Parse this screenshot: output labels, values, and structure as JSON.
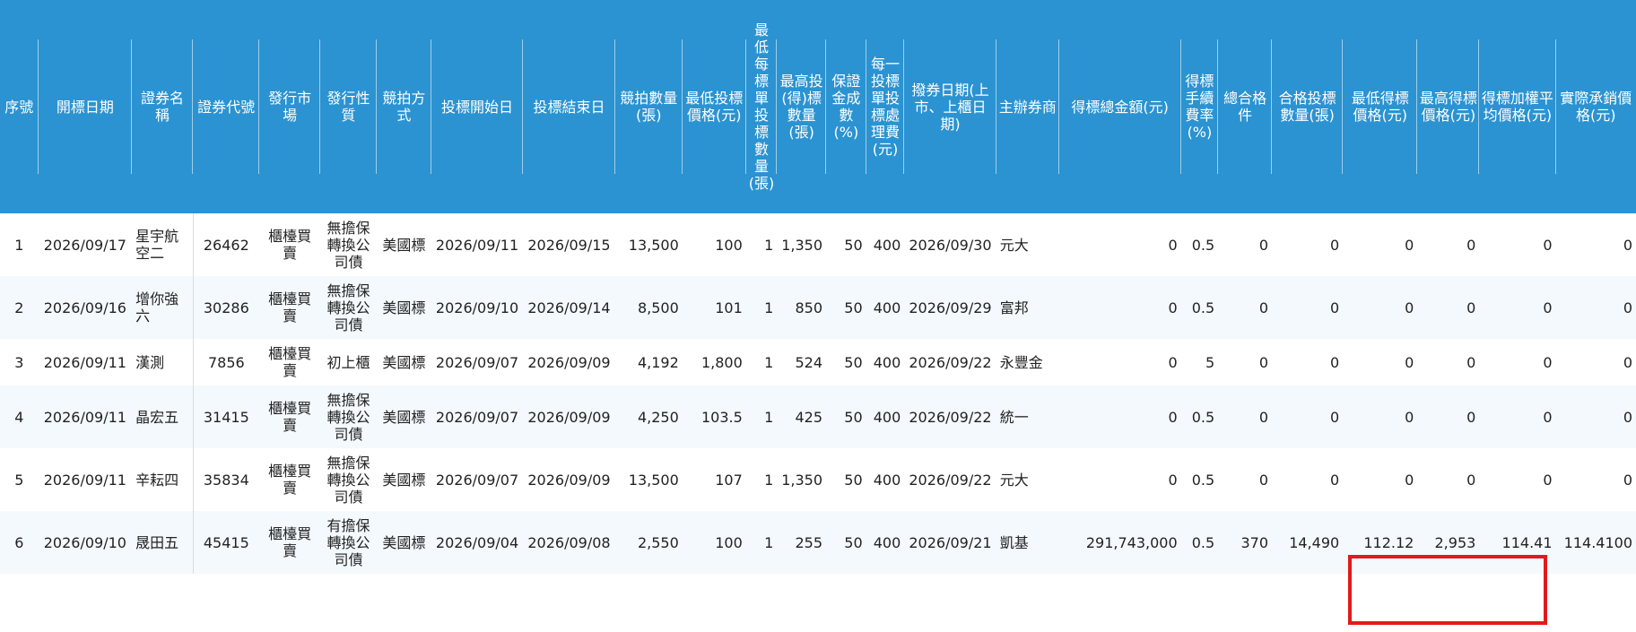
{
  "headers": [
    "序號",
    "開標日期",
    "證券名稱",
    "證券代號",
    "發行市場",
    "發行性質",
    "競拍方式",
    "投標開始日",
    "投標結束日",
    "競拍數量(張)",
    "最低投標價格(元)",
    "最低每標單投標數量(張)",
    "最高投(得)標數量(張)",
    "保證金成數(%)",
    "每一投標單投標處理費(元)",
    "撥券日期(上市、上櫃日期)",
    "主辦券商",
    "得標總金額(元)",
    "得標手續費率(%)",
    "總合格件",
    "合格投標數量(張)",
    "最低得標價格(元)",
    "最高得標價格(元)",
    "得標加權平均價格(元)",
    "實際承銷價格(元)"
  ],
  "rows": [
    [
      "1",
      "2026/09/17",
      "星宇航空二",
      "26462",
      "櫃檯買賣",
      "無擔保轉換公司債",
      "美國標",
      "2026/09/11",
      "2026/09/15",
      "13,500",
      "100",
      "1",
      "1,350",
      "50",
      "400",
      "2026/09/30",
      "元大",
      "0",
      "0.5",
      "0",
      "0",
      "0",
      "0",
      "0",
      "0"
    ],
    [
      "2",
      "2026/09/16",
      "增你強六",
      "30286",
      "櫃檯買賣",
      "無擔保轉換公司債",
      "美國標",
      "2026/09/10",
      "2026/09/14",
      "8,500",
      "101",
      "1",
      "850",
      "50",
      "400",
      "2026/09/29",
      "富邦",
      "0",
      "0.5",
      "0",
      "0",
      "0",
      "0",
      "0",
      "0"
    ],
    [
      "3",
      "2026/09/11",
      "漢測",
      "7856",
      "櫃檯買賣",
      "初上櫃",
      "美國標",
      "2026/09/07",
      "2026/09/09",
      "4,192",
      "1,800",
      "1",
      "524",
      "50",
      "400",
      "2026/09/22",
      "永豐金",
      "0",
      "5",
      "0",
      "0",
      "0",
      "0",
      "0",
      "0"
    ],
    [
      "4",
      "2026/09/11",
      "晶宏五",
      "31415",
      "櫃檯買賣",
      "無擔保轉換公司債",
      "美國標",
      "2026/09/07",
      "2026/09/09",
      "4,250",
      "103.5",
      "1",
      "425",
      "50",
      "400",
      "2026/09/22",
      "統一",
      "0",
      "0.5",
      "0",
      "0",
      "0",
      "0",
      "0",
      "0"
    ],
    [
      "5",
      "2026/09/11",
      "辛耘四",
      "35834",
      "櫃檯買賣",
      "無擔保轉換公司債",
      "美國標",
      "2026/09/07",
      "2026/09/09",
      "13,500",
      "107",
      "1",
      "1,350",
      "50",
      "400",
      "2026/09/22",
      "元大",
      "0",
      "0.5",
      "0",
      "0",
      "0",
      "0",
      "0",
      "0"
    ],
    [
      "6",
      "2026/09/10",
      "晟田五",
      "45415",
      "櫃檯買賣",
      "有擔保轉換公司債",
      "美國標",
      "2026/09/04",
      "2026/09/08",
      "2,550",
      "100",
      "1",
      "255",
      "50",
      "400",
      "2026/09/21",
      "凱基",
      "291,743,000",
      "0.5",
      "370",
      "14,490",
      "112.12",
      "2,953",
      "114.41",
      "114.4100"
    ]
  ],
  "highlight_color": "#e21a1a",
  "header_bg": "#2b93d1"
}
